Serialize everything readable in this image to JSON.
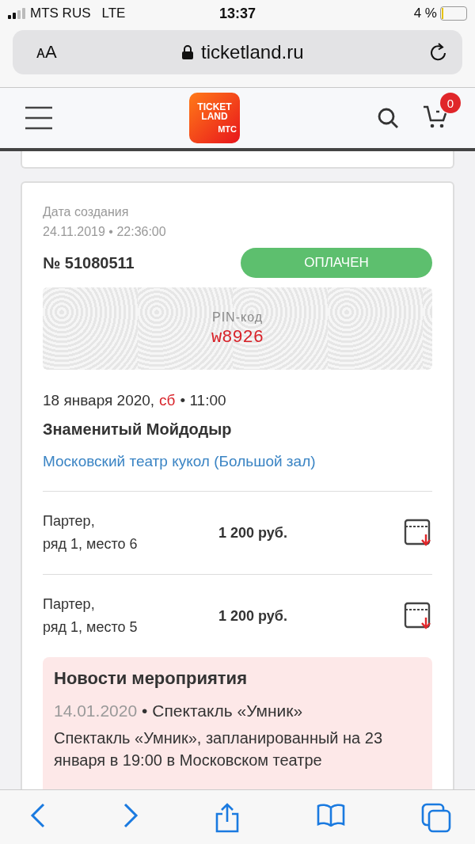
{
  "status_bar": {
    "carrier": "MTS RUS",
    "network": "LTE",
    "time": "13:37",
    "battery_percent": "4 %",
    "level": 0.04
  },
  "address_bar": {
    "text_size": "ᴀA",
    "url": "ticketland.ru"
  },
  "header": {
    "logo_top": "TICKET",
    "logo_middle": "LAND",
    "logo_bottom": "МТС",
    "cart_count": "0"
  },
  "order": {
    "created_label": "Дата создания",
    "created": "24.11.2019 • 22:36:00",
    "number": "№ 51080511",
    "status": {
      "kind": "paid",
      "label": "ОПЛАЧЕН"
    },
    "pin_label": "PIN-код",
    "pin": "w8926",
    "date": "18 января 2020,",
    "weekday": "сб",
    "time": "• 11:00",
    "title": "Знаменитый Мойдодыр",
    "venue": "Московский театр кукол (Большой зал)",
    "tickets": [
      {
        "section": "Партер,",
        "seat": "ряд 1, место 6",
        "price": "1 200 руб."
      },
      {
        "section": "Партер,",
        "seat": "ряд 1, место 5",
        "price": "1 200 руб."
      }
    ],
    "news": {
      "heading": "Новости мероприятия",
      "date": "14.01.2020",
      "title": "• Спектакль «Умник»",
      "text": "Спектакль «Умник», запланированный на 23 января в 19:00 в Московском театре"
    }
  }
}
